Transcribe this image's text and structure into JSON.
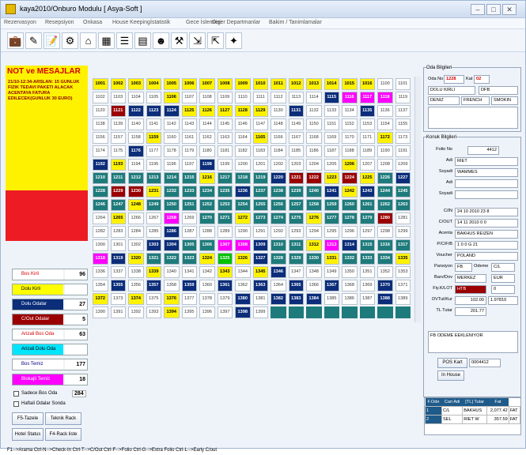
{
  "window": {
    "title": "kaya2010/Onburo Modulu [ Asya-Soft ]"
  },
  "menu": [
    "Rezervasyon",
    "Resepsiyon",
    "Onkasa",
    "House Keeping",
    "İstatistik",
    "Gece İslemleri",
    "Diger Departmanlar",
    "Bakim / Tanimlamalar"
  ],
  "toolbar": [
    "suitcase-icon",
    "pencil-icon",
    "notepad-icon",
    "gear-icon",
    "house-icon",
    "calendar-icon",
    "list-icon",
    "calculator-icon",
    "person-icon",
    "tool-icon",
    "arrow-in-icon",
    "arrow-out-icon",
    "tag-icon"
  ],
  "notes": {
    "title": "NOT ve MESAJLAR",
    "body": "21/10-12:34-ARSLAN: 15 GUNLUK FIZIK TEDAVI PAKETI ALACAK ACENTAYA FATURA EDILECEK(GUNLUK 30 EURO)"
  },
  "stats": [
    {
      "label": "Bos Kirli",
      "value": "96",
      "color": "#ffffff",
      "text": "#d40000",
      "checked": true
    },
    {
      "label": "Dolu Kirli",
      "value": "",
      "color": "#ffff00",
      "text": "#000000",
      "checked": true
    },
    {
      "label": "Dolu Odalar",
      "value": "27",
      "color": "#0b2d7a",
      "text": "#ffffff",
      "checked": true
    },
    {
      "label": "C/Out Odalar",
      "value": "5",
      "color": "#9b0000",
      "text": "#ffffff",
      "checked": true
    },
    {
      "label": "Arizali Bos Oda",
      "value": "63",
      "color": "#ffffff",
      "text": "#d40000",
      "checked": true
    },
    {
      "label": "Arizali Dolu Oda",
      "value": "",
      "color": "#00e5ff",
      "text": "#000000",
      "checked": true
    },
    {
      "label": "Bos Temiz",
      "value": "177",
      "color": "#ffffff",
      "text": "#000080",
      "checked": true
    },
    {
      "label": "Blokajli Temiz",
      "value": "18",
      "color": "#ff00ff",
      "text": "#ffffff",
      "checked": true
    }
  ],
  "only_empty": {
    "label": "Sadece Bos Oda",
    "value": "284"
  },
  "weekly": {
    "label": "Haftali Odalar Sonda"
  },
  "buttons": {
    "refresh": "F5-Tazele",
    "tech_rack": "Teknik Rack",
    "hotel_status": "Hotel Status",
    "rack_list": "F4-Rack liste"
  },
  "rows": [
    [
      "1001",
      "1002",
      "1003",
      "1004",
      "1005",
      "1006",
      "1007",
      "1008",
      "1009",
      "1010",
      "1011",
      "1012",
      "1013",
      "1014",
      "1015",
      "1016",
      "1100",
      "1101"
    ],
    [
      "1102",
      "1103",
      "1104",
      "1105",
      "1106",
      "1107",
      "1108",
      "1109",
      "1110",
      "1111",
      "1112",
      "1113",
      "1114",
      "1115",
      "1116",
      "1117",
      "1118",
      "1119"
    ],
    [
      "1120",
      "1121",
      "1122",
      "1123",
      "1124",
      "1125",
      "1126",
      "1127",
      "1128",
      "1129",
      "1130",
      "1131",
      "1132",
      "1133",
      "1134",
      "1135",
      "1136",
      "1137"
    ],
    [
      "1138",
      "1139",
      "1140",
      "1141",
      "1142",
      "1143",
      "1144",
      "1145",
      "1146",
      "1147",
      "1148",
      "1149",
      "1150",
      "1151",
      "1152",
      "1153",
      "1154",
      "1155"
    ],
    [
      "1156",
      "1157",
      "1158",
      "1159",
      "1160",
      "1161",
      "1162",
      "1163",
      "1164",
      "1165",
      "1166",
      "1167",
      "1168",
      "1169",
      "1170",
      "1171",
      "1172",
      "1173"
    ],
    [
      "1174",
      "1175",
      "1176",
      "1177",
      "1178",
      "1179",
      "1180",
      "1181",
      "1182",
      "1183",
      "1184",
      "1185",
      "1186",
      "1187",
      "1188",
      "1189",
      "1190",
      "1191"
    ],
    [
      "1192",
      "1193",
      "1194",
      "1195",
      "1196",
      "1197",
      "1198",
      "1199",
      "1200",
      "1201",
      "1202",
      "1203",
      "1204",
      "1205",
      "1206",
      "1207",
      "1208",
      "1209"
    ],
    [
      "1210",
      "1211",
      "1212",
      "1213",
      "1214",
      "1215",
      "1216",
      "1217",
      "1218",
      "1219",
      "1220",
      "1221",
      "1222",
      "1223",
      "1224",
      "1225",
      "1226",
      "1227"
    ],
    [
      "1228",
      "1229",
      "1230",
      "1231",
      "1232",
      "1233",
      "1234",
      "1235",
      "1236",
      "1237",
      "1238",
      "1239",
      "1240",
      "1241",
      "1242",
      "1243",
      "1244",
      "1245"
    ],
    [
      "1246",
      "1247",
      "1248",
      "1249",
      "1250",
      "1251",
      "1252",
      "1253",
      "1254",
      "1255",
      "1256",
      "1257",
      "1258",
      "1259",
      "1260",
      "1261",
      "1262",
      "1263"
    ],
    [
      "1264",
      "1265",
      "1266",
      "1267",
      "1268",
      "1269",
      "1270",
      "1271",
      "1272",
      "1273",
      "1274",
      "1275",
      "1276",
      "1277",
      "1278",
      "1279",
      "1280",
      "1281"
    ],
    [
      "1282",
      "1283",
      "1284",
      "1285",
      "1286",
      "1287",
      "1288",
      "1289",
      "1290",
      "1291",
      "1292",
      "1293",
      "1294",
      "1295",
      "1296",
      "1297",
      "1298",
      "1299"
    ],
    [
      "1300",
      "1301",
      "1302",
      "1303",
      "1304",
      "1305",
      "1306",
      "1307",
      "1308",
      "1309",
      "1310",
      "1311",
      "1312",
      "1313",
      "1314",
      "1315",
      "1316",
      "1317"
    ],
    [
      "1318",
      "1319",
      "1320",
      "1321",
      "1322",
      "1323",
      "1324",
      "1325",
      "1326",
      "1327",
      "1328",
      "1329",
      "1330",
      "1331",
      "1332",
      "1333",
      "1334",
      "1335"
    ],
    [
      "1336",
      "1337",
      "1338",
      "1339",
      "1340",
      "1341",
      "1342",
      "1343",
      "1344",
      "1345",
      "1346",
      "1347",
      "1348",
      "1349",
      "1350",
      "1351",
      "1352",
      "1353"
    ],
    [
      "1354",
      "1355",
      "1356",
      "1357",
      "1358",
      "1359",
      "1360",
      "1361",
      "1362",
      "1363",
      "1364",
      "1365",
      "1366",
      "1367",
      "1368",
      "1369",
      "1370",
      "1371"
    ],
    [
      "1372",
      "1373",
      "1374",
      "1375",
      "1376",
      "1377",
      "1378",
      "1379",
      "1380",
      "1381",
      "1382",
      "1383",
      "1384",
      "1385",
      "1386",
      "1387",
      "1388",
      "1389"
    ],
    [
      "1390",
      "1391",
      "1392",
      "1393",
      "1394",
      "1395",
      "1396",
      "1397",
      "1398",
      "1399",
      "",
      "",
      "",
      "",
      "",
      "",
      "",
      ""
    ]
  ],
  "cell_styles": {
    "1001": "y",
    "1002": "y",
    "1003": "y",
    "1004": "y",
    "1005": "y",
    "1006": "y",
    "1007": "y",
    "1008": "y",
    "1009": "y",
    "1010": "y",
    "1011": "y",
    "1012": "y",
    "1013": "y",
    "1014": "y",
    "1015": "y",
    "1016": "y",
    "1106": "yb",
    "1115": "n",
    "1116": "m",
    "1117": "m",
    "1118": "m",
    "1121": "r",
    "1122": "n",
    "1123": "n",
    "1124": "n",
    "1125": "y",
    "1126": "y",
    "1127": "y",
    "1128": "y",
    "1129": "y",
    "1131": "n",
    "1135": "n",
    "1159": "y",
    "1165": "y",
    "1172": "y",
    "1176": "n",
    "1192": "n",
    "1193": "y",
    "1198": "n",
    "1206": "y",
    "1210": "t",
    "1211": "t",
    "1212": "t",
    "1213": "t",
    "1214": "t",
    "1215": "t",
    "1216": "y",
    "1217": "t",
    "1218": "t",
    "1219": "t",
    "1220": "n",
    "1221": "r",
    "1222": "r",
    "1223": "y",
    "1224": "r",
    "1225": "y",
    "1226": "t",
    "1227": "n",
    "1228": "t",
    "1229": "r",
    "1230": "r",
    "1231": "y",
    "1232": "t",
    "1233": "t",
    "1234": "t",
    "1235": "t",
    "1236": "n",
    "1237": "t",
    "1238": "t",
    "1239": "t",
    "1240": "t",
    "1241": "n",
    "1242": "y",
    "1243": "n",
    "1244": "t",
    "1245": "t",
    "1246": "t",
    "1247": "t",
    "1248": "y",
    "1249": "t",
    "1250": "t",
    "1251": "t",
    "1252": "t",
    "1253": "t",
    "1254": "t",
    "1255": "t",
    "1256": "t",
    "1257": "t",
    "1258": "t",
    "1259": "t",
    "1260": "t",
    "1261": "t",
    "1262": "t",
    "1263": "t",
    "1265": "y",
    "1268": "m",
    "1270": "t",
    "1271": "t",
    "1272": "y",
    "1273": "t",
    "1274": "t",
    "1275": "t",
    "1276": "y",
    "1277": "t",
    "1278": "t",
    "1279": "t",
    "1280": "r",
    "1286": "n",
    "1303": "n",
    "1304": "n",
    "1305": "t",
    "1306": "t",
    "1307": "m",
    "1308": "m",
    "1309": "n",
    "1310": "t",
    "1311": "t",
    "1312": "y",
    "1313": "m",
    "1314": "n",
    "1315": "t",
    "1316": "t",
    "1317": "t",
    "1318": "m",
    "1319": "n",
    "1320": "y",
    "1321": "t",
    "1322": "t",
    "1323": "t",
    "1324": "y",
    "1325": "g",
    "1326": "y",
    "1327": "n",
    "1328": "t",
    "1329": "t",
    "1330": "t",
    "1331": "y",
    "1332": "t",
    "1333": "t",
    "1334": "t",
    "1335": "y",
    "1339": "y",
    "1343": "y",
    "1345": "y",
    "1346": "n",
    "1355": "n",
    "1357": "n",
    "1359": "n",
    "1361": "n",
    "1363": "n",
    "1365": "n",
    "1367": "n",
    "1370": "n",
    "1372": "y",
    "1374": "y",
    "1376": "y",
    "1380": "n",
    "1382": "n",
    "1383": "n",
    "1384": "n",
    "1388": "n",
    "1394": "y",
    "1398": "n"
  },
  "room_info": {
    "title": "Oda Bilgileri",
    "room_no_label": "Oda No",
    "room_no": "1228",
    "floor_label": "Kat",
    "floor": "02",
    "status": "DOLU KIRLI",
    "type": "DFB",
    "view": "DENIZ",
    "bed": "FRENCH",
    "smoke": "SMOKIN"
  },
  "guest": {
    "title": "Konuk Bilgileri",
    "folio_label": "Folio No",
    "folio": "4412",
    "name_label": "Adi",
    "name": "RIET",
    "surname_label": "Soyadi",
    "surname": "WAMMES",
    "name2_label": "Adi",
    "name2": "",
    "surname2_label": "Soyadi",
    "surname2": "",
    "cin_label": "C/IN",
    "cin": "24  10  2010  23  8",
    "cout_label": "C/OUT",
    "cout": "14  11  2010  0  0",
    "agency_label": "Acenta",
    "agency": "BAKHUS REIZEN",
    "pcfb_label": "P/C/F/B",
    "pcfb": "1  0  0  G  21",
    "voucher_label": "Voucher",
    "voucher": "POLAND",
    "pansion_label": "Pansiyon",
    "pansion": "FB",
    "payment_label": "Odeme",
    "payment": "C/L",
    "barv_label": "Barv/Dov",
    "barv": "MERKEZ",
    "currency": "EUR",
    "fiy_label": "Fiy.K/LOT",
    "fiy": "HTB",
    "fiy2": "0",
    "dvtut_label": "DVTut/Kur",
    "dvtut": "102.00",
    "kur": "1.97810",
    "tl_label": "TL Tutar",
    "tl": "201.77",
    "note": "FB ODEME EEKLENIYOR"
  },
  "pos": {
    "button": "POS Kart",
    "value": "0004412",
    "inhouse": "In House"
  },
  "folio_table": {
    "headers": [
      "F.Ode",
      "Cari Adi",
      "[TL] Tutar",
      "Fat"
    ],
    "rows": [
      [
        "1",
        "C/L",
        "BAKHUS",
        "2,077.42",
        "FAT"
      ],
      [
        "2",
        "SEL",
        "RIET W",
        "357.59",
        "FAT"
      ]
    ]
  },
  "statusbar": "F1-->Arama   Ctrl-N-->Check-In   Ctrl-T-->C/Out   Ctrl-F-->Folio   Ctrl-G-->Extra Folio   Ctrl-L-->Early C/out"
}
